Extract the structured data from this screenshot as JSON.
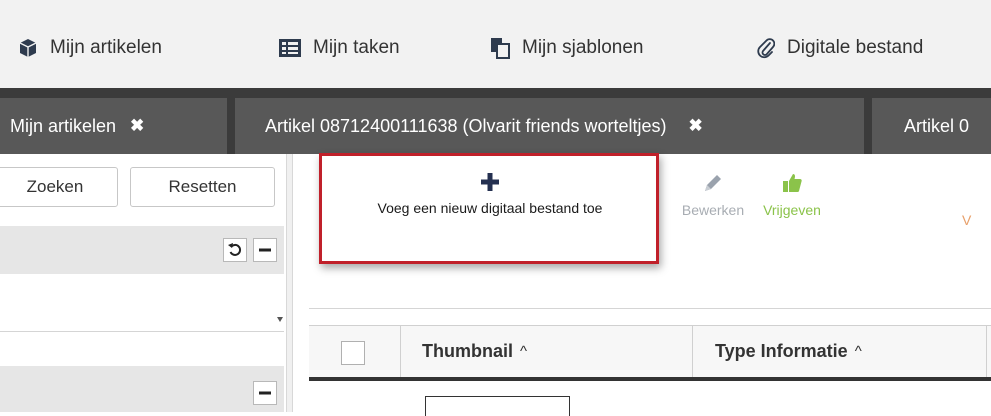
{
  "topnav": {
    "items": [
      {
        "label": "Mijn artikelen",
        "icon": "cube-icon"
      },
      {
        "label": "Mijn taken",
        "icon": "task-list-icon"
      },
      {
        "label": "Mijn sjablonen",
        "icon": "template-copy-icon"
      },
      {
        "label": "Digitale bestand",
        "icon": "paperclip-icon"
      }
    ]
  },
  "tabs": [
    {
      "label": "Mijn artikelen",
      "close": "✖"
    },
    {
      "label": "Artikel 08712400111638 (Olvarit friends worteltjes)",
      "close": "✖"
    },
    {
      "label": "Artikel 0",
      "close": ""
    }
  ],
  "left_panel": {
    "search_label": "Zoeken",
    "reset_label": "Resetten"
  },
  "actions": {
    "add_label": "Voeg een nieuw digitaal bestand toe",
    "edit_label": "Bewerken",
    "release_label": "Vrijgeven",
    "cut_label": "V"
  },
  "grid": {
    "columns": [
      {
        "label": "Thumbnail",
        "sort": "^"
      },
      {
        "label": "Type Informatie",
        "sort": "^"
      }
    ]
  },
  "colors": {
    "accent_red": "#c0202a",
    "release_green": "#8bc34a",
    "tab_bar": "#3b3b3b",
    "tab": "#585858"
  }
}
